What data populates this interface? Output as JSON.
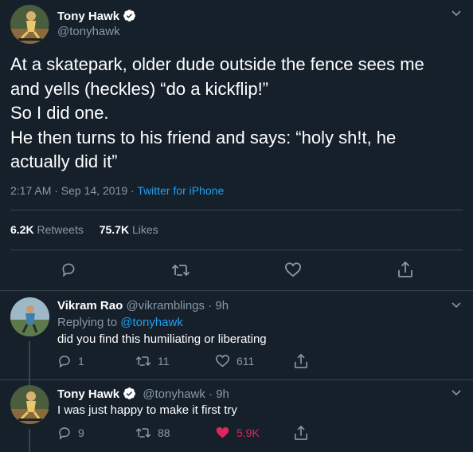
{
  "main_tweet": {
    "author_name": "Tony Hawk",
    "author_handle": "@tonyhawk",
    "text_lines": [
      "At a skatepark, older dude outside the fence sees me",
      "and yells (heckles) “do a kickflip!”",
      "So I did one.",
      "He then turns to his friend and says: “holy sh!t, he",
      "actually did it”"
    ],
    "timestamp": "2:17 AM · Sep 14, 2019 · ",
    "source": "Twitter for iPhone",
    "retweets_count": "6.2K",
    "retweets_label": "Retweets",
    "likes_count": "75.7K",
    "likes_label": "Likes"
  },
  "replies": [
    {
      "author_name": "Vikram Rao",
      "author_handle": "@vikramblings",
      "time": " · 9h",
      "replying_prefix": "Replying to ",
      "replying_to": "@tonyhawk",
      "text": "did you find this humiliating or liberating",
      "reply_count": "1",
      "retweet_count": "11",
      "like_count": "611"
    },
    {
      "author_name": "Tony Hawk",
      "author_handle": "@tonyhawk",
      "time": " · 9h",
      "text": "I was just happy to make it first try",
      "reply_count": "9",
      "retweet_count": "88",
      "like_count": "5.9K"
    }
  ],
  "colors": {
    "background": "#15202b",
    "muted": "#8899a6",
    "link": "#1da1f2",
    "like": "#e0245e",
    "divider": "#38444d"
  },
  "icons": [
    "verified-badge-icon",
    "chevron-down-icon",
    "reply-icon",
    "retweet-icon",
    "like-icon",
    "share-icon"
  ]
}
